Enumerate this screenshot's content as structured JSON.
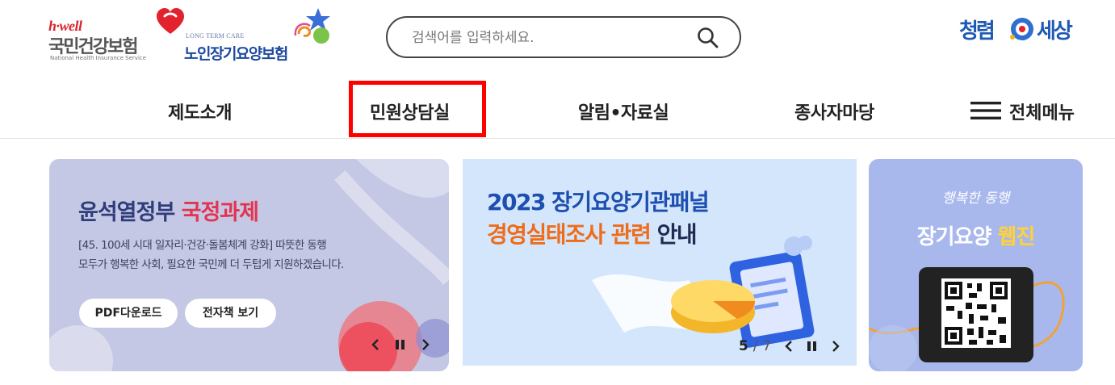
{
  "header": {
    "nhis_logo": {
      "brand": "h·well",
      "name": "국민건강보험",
      "english": "National Health Insurance Service"
    },
    "ltci_logo": {
      "english": "LONG TERM CARE",
      "name": "노인장기요양보험"
    },
    "search": {
      "placeholder": "검색어를 입력하세요.",
      "value": "",
      "icon": "search-icon"
    },
    "right_logo": {
      "left": "청렴",
      "right": "세상",
      "badge_icon": "clean-world-emblem"
    }
  },
  "nav": {
    "items": [
      {
        "label": "제도소개"
      },
      {
        "label": "민원상담실",
        "highlighted": true
      },
      {
        "label": "알림•자료실"
      },
      {
        "label": "종사자마당"
      }
    ],
    "all_menu": {
      "label": "전체메뉴",
      "icon": "hamburger-icon"
    },
    "highlight_color": "#ff0000"
  },
  "banners": {
    "policy": {
      "title_main": "윤석열정부",
      "title_accent": "국정과제",
      "desc_line1": "[45. 100세 시대 일자리·건강·돌봄체계 강화] 따뜻한 동행",
      "desc_line2": "모두가 행복한 사회, 필요한 국민께 더 두텁게 지원하겠습니다.",
      "button_pdf": "PDF다운로드",
      "button_ebook": "전자책 보기",
      "colors": {
        "accent": "#e23450",
        "title": "#2f3d7a",
        "background": "#c5c8e4"
      }
    },
    "panel": {
      "title": "2023 장기요양기관패널",
      "subtitle_accent": "경영실태조사 관련",
      "subtitle_dark": "안내",
      "current": "5",
      "separator": "/",
      "total": "7",
      "colors": {
        "title": "#1d4fb0",
        "accent": "#ee6c1a",
        "background": "#d4e6fb"
      }
    },
    "webzine": {
      "script": "행복한 동행",
      "title_main": "장기요양",
      "title_accent": "웹진",
      "colors": {
        "background": "#a8b8ec",
        "accent": "#ffd23a"
      }
    }
  }
}
